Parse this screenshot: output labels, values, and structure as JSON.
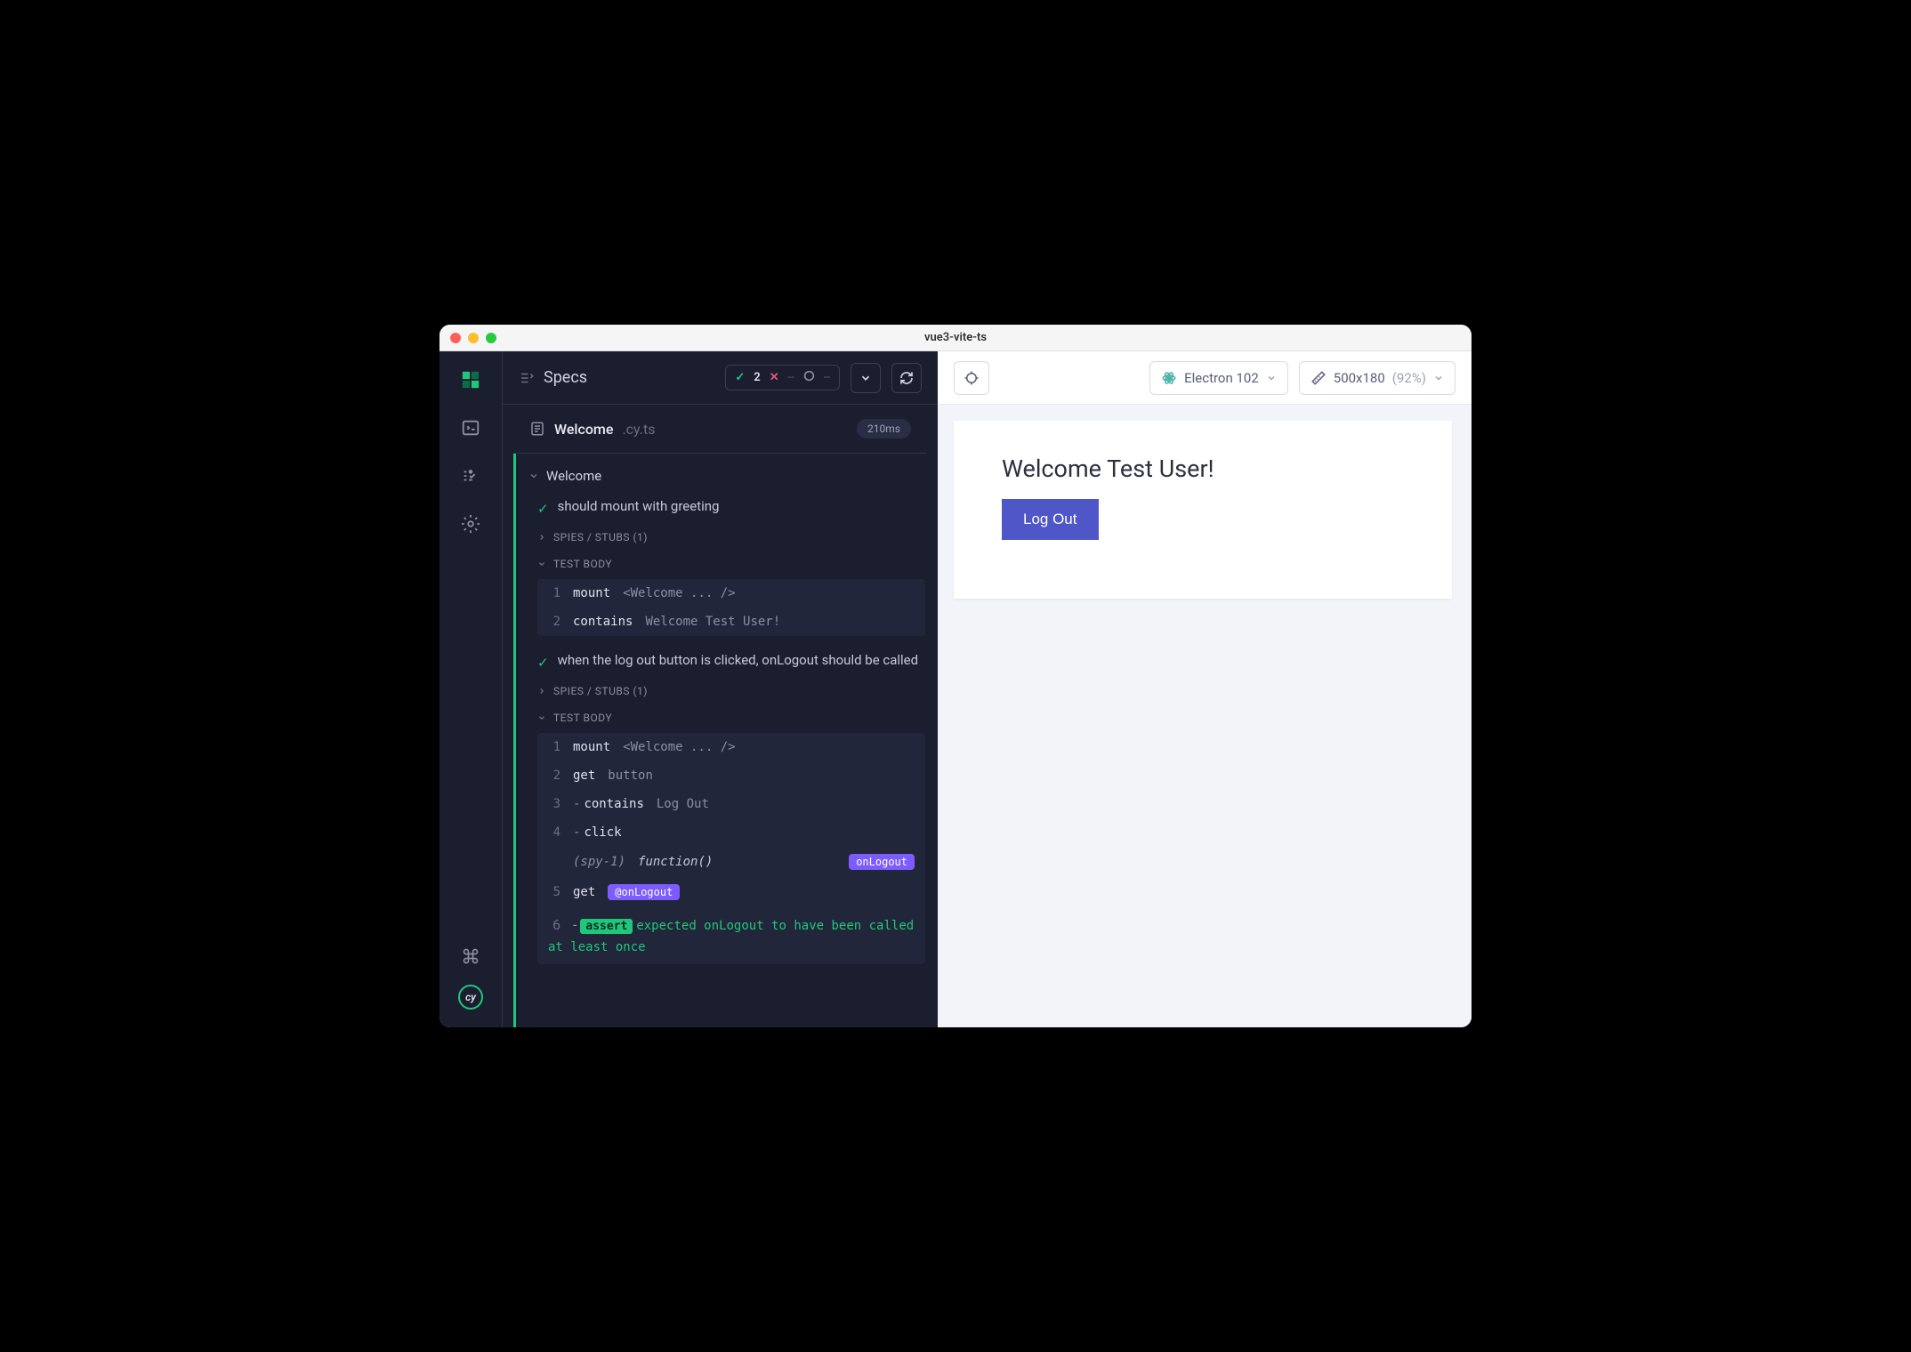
{
  "window": {
    "title": "vue3-vite-ts"
  },
  "reporter": {
    "specs_label": "Specs",
    "stats": {
      "passed": "2",
      "failed": "--",
      "pending": "--"
    },
    "spec": {
      "name": "Welcome",
      "ext": ".cy.ts",
      "duration": "210ms"
    },
    "suite": {
      "name": "Welcome"
    },
    "tests": [
      {
        "title": "should mount with greeting",
        "sections": [
          {
            "label": "SPIES / STUBS (1)",
            "expanded": false
          },
          {
            "label": "TEST BODY",
            "expanded": true,
            "commands": [
              {
                "num": "1",
                "name": "mount",
                "arg": "<Welcome ... />"
              },
              {
                "num": "2",
                "name": "contains",
                "arg": "Welcome Test User!"
              }
            ]
          }
        ]
      },
      {
        "title": "when the log out button is clicked, onLogout should be called",
        "sections": [
          {
            "label": "SPIES / STUBS (1)",
            "expanded": false
          },
          {
            "label": "TEST BODY",
            "expanded": true,
            "commands": [
              {
                "num": "1",
                "name": "mount",
                "arg": "<Welcome ... />"
              },
              {
                "num": "2",
                "name": "get",
                "arg": "button"
              },
              {
                "num": "3",
                "dash": true,
                "name": "contains",
                "arg": "Log Out"
              },
              {
                "num": "4",
                "dash": true,
                "name": "click",
                "arg": ""
              },
              {
                "num": "",
                "spy": "(spy-1)",
                "func": "function()",
                "alias_right": "onLogout"
              },
              {
                "num": "5",
                "name": "get",
                "alias": "@onLogout"
              },
              {
                "num": "6",
                "dash": true,
                "assert": "assert",
                "assert_text": "expected onLogout to have been called at least once"
              }
            ]
          }
        ]
      }
    ]
  },
  "toolbar": {
    "browser": "Electron 102",
    "viewport": "500x180",
    "scale": "(92%)"
  },
  "aut": {
    "heading": "Welcome Test User!",
    "button": "Log Out"
  },
  "cy_badge": "cy"
}
